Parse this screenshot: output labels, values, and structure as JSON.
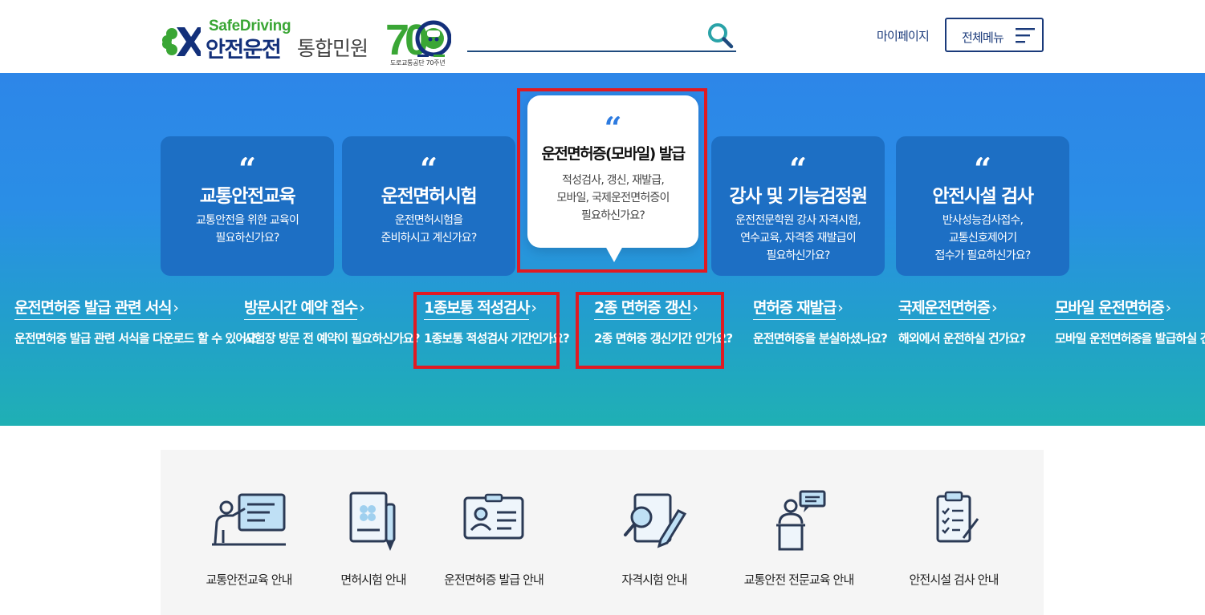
{
  "header": {
    "logo": {
      "brand": "SafeDriving",
      "main": "안전운전",
      "sub": "통합민원",
      "anniversary": "도로교통공단 70주년",
      "anniversary_number": "70"
    },
    "search": {
      "placeholder": "",
      "value": ""
    },
    "mypage": "마이페이지",
    "all_menu": "전체메뉴"
  },
  "hero": {
    "cards": [
      {
        "title": "교통안전교육",
        "desc": "교통안전을 위한 교육이\n필요하신가요?"
      },
      {
        "title": "운전면허시험",
        "desc": "운전면허시험을\n준비하시고 계신가요?"
      },
      {
        "title": "운전면허증(모바일) 발급",
        "desc": "적성검사, 갱신, 재발급,\n모바일, 국제운전면허증이\n필요하신가요?",
        "active": true
      },
      {
        "title": "강사 및 기능검정원",
        "desc": "운전전문학원 강사 자격시험,\n연수교육, 자격증 재발급이\n필요하신가요?"
      },
      {
        "title": "안전시설 검사",
        "desc": "반사성능검사접수,\n교통신호제어기\n접수가 필요하신가요?"
      }
    ],
    "quote_glyph": "“",
    "links": [
      {
        "title": "운전면허증 발급 관련 서식",
        "desc": "운전면허증 발급 관련 서식을\n다운로드 할 수 있어요"
      },
      {
        "title": "방문시간 예약 접수",
        "desc": "시험장 방문 전\n예약이 필요하신가요?"
      },
      {
        "title": "1종보통 적성검사",
        "desc": "1종보통 적성검사\n기간인가요?"
      },
      {
        "title": "2종 면허증 갱신",
        "desc": "2종 면허증 갱신기간\n인가요?"
      },
      {
        "title": "면허증 재발급",
        "desc": "운전면허증을\n분실하셨나요?"
      },
      {
        "title": "국제운전면허증",
        "desc": "해외에서\n운전하실 건가요?"
      },
      {
        "title": "모바일 운전면허증",
        "desc": "모바일 운전면허증을\n발급하실 건가요?"
      }
    ],
    "arrow_glyph": "›"
  },
  "quick_menu": [
    {
      "label": "교통안전교육 안내",
      "icon": "presentation-icon"
    },
    {
      "label": "면허시험 안내",
      "icon": "document-pen-icon"
    },
    {
      "label": "운전면허증 발급 안내",
      "icon": "id-card-icon"
    },
    {
      "label": "자격시험 안내",
      "icon": "exam-search-icon"
    },
    {
      "label": "교통안전 전문교육 안내",
      "icon": "lecturer-icon"
    },
    {
      "label": "안전시설 검사 안내",
      "icon": "checklist-icon"
    }
  ],
  "colors": {
    "brand_navy": "#13307a",
    "brand_green": "#3aa635",
    "hero_card": "#1d6fc4",
    "highlight": "#e01a22"
  }
}
